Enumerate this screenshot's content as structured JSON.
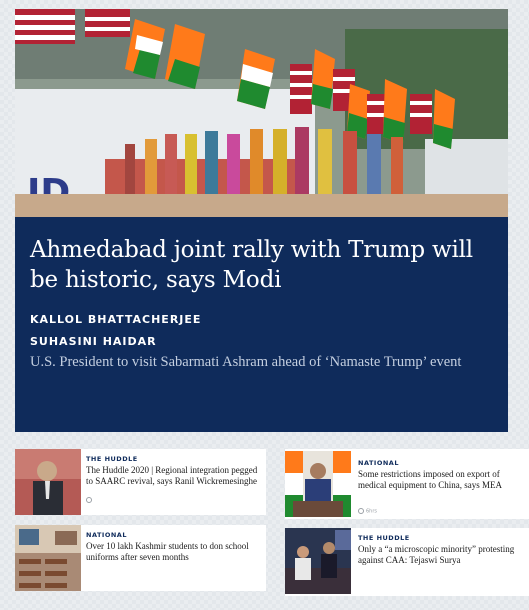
{
  "featured": {
    "headline": "Ahmedabad joint rally with Trump will be historic, says Modi",
    "authors": [
      "KALLOL BHATTACHERJEE",
      "SUHASINI HAIDAR"
    ],
    "summary": "U.S. President to visit Sabarmati Ashram ahead of ‘Namaste Trump’ event",
    "image_signage": "ID",
    "colors": {
      "panel": "#0f2b5b",
      "saffron": "#ff7a1a",
      "green": "#1f8a2f"
    }
  },
  "stories": [
    {
      "category": "THE HUDDLE",
      "headline": "The Huddle 2020 | Regional integration pegged to SAARC revival, says Ranil Wickremesinghe",
      "icon": "clock-icon"
    },
    {
      "category": "NATIONAL",
      "headline": "Some restrictions imposed on export of medical equipment to China, says MEA",
      "time": "6hrs",
      "icon": "clock-icon"
    },
    {
      "category": "NATIONAL",
      "headline": "Over 10 lakh Kashmir students to don school uniforms after seven months"
    },
    {
      "category": "THE HUDDLE",
      "headline": "Only a “a microscopic minority” protesting against CAA: Tejaswi Surya"
    }
  ]
}
